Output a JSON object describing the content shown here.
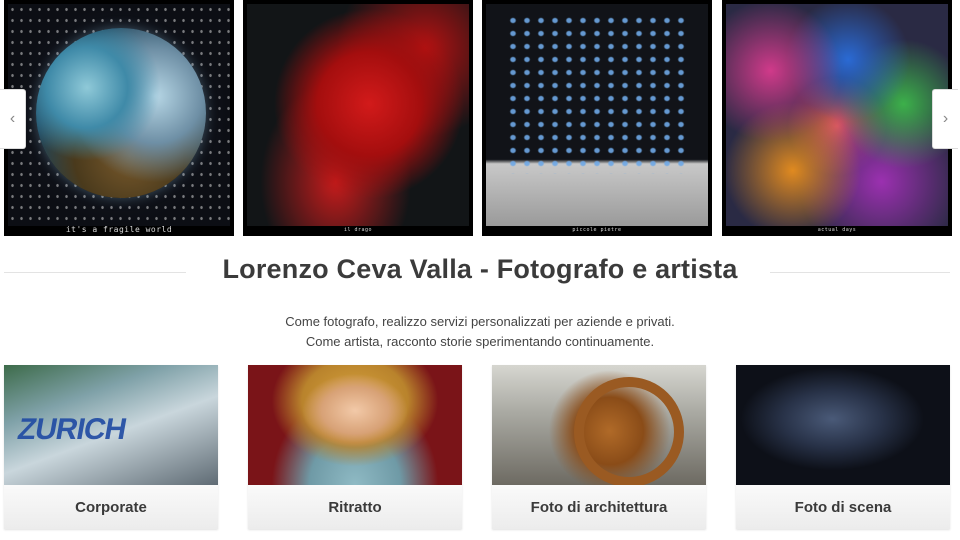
{
  "carousel": {
    "prev_icon": "chevron-left-icon",
    "next_icon": "chevron-right-icon",
    "prev_glyph": "‹",
    "next_glyph": "›",
    "slides": [
      {
        "caption": "it's a fragile world"
      },
      {
        "caption": "il drago"
      },
      {
        "caption": "piccole pietre"
      },
      {
        "caption": "actual days"
      }
    ]
  },
  "heading": {
    "title": "Lorenzo Ceva Valla - Fotografo e artista"
  },
  "intro": {
    "line1": "Come fotografo, realizzo servizi personalizzati per aziende e privati.",
    "line2": "Come artista, racconto storie sperimentando continuamente."
  },
  "categories": [
    {
      "label": "Corporate",
      "photo_text": "ZURICH"
    },
    {
      "label": "Ritratto"
    },
    {
      "label": "Foto di architettura"
    },
    {
      "label": "Foto di scena"
    }
  ],
  "colors": {
    "heading": "#3b3b3b",
    "text": "#444444",
    "card_bg": "#f4f4f4"
  }
}
